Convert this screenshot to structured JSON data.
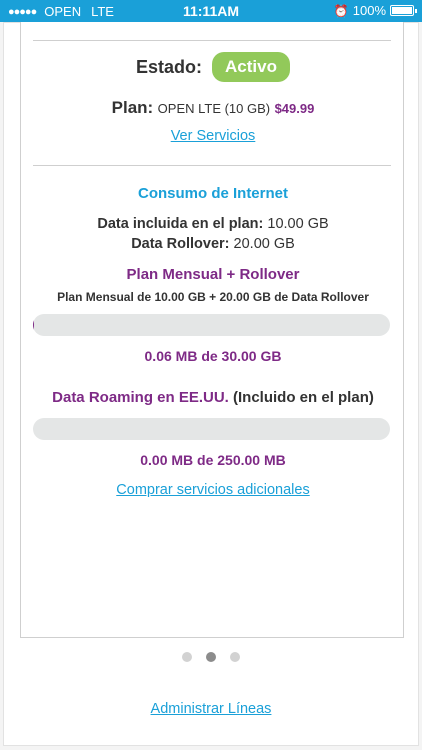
{
  "status_bar": {
    "carrier": "OPEN",
    "network": "LTE",
    "time": "11:11AM",
    "battery": "100%"
  },
  "account": {
    "estado_label": "Estado:",
    "estado_value": "Activo",
    "plan_label": "Plan:",
    "plan_name": "OPEN LTE (10 GB)",
    "plan_price": "$49.99",
    "ver_servicios": "Ver Servicios"
  },
  "internet": {
    "title": "Consumo de Internet",
    "included_label": "Data incluida en el plan:",
    "included_value": "10.00 GB",
    "rollover_label": "Data Rollover:",
    "rollover_value": "20.00 GB",
    "plan_type_title": "Plan Mensual + Rollover",
    "plan_type_desc": "Plan Mensual de 10.00 GB + 20.00 GB de Data Rollover",
    "usage_progress": 0.002,
    "usage_text": "0.06 MB de 30.00 GB",
    "roaming_title": "Data Roaming en EE.UU.",
    "roaming_note": "(Incluido en el plan)",
    "roaming_progress": 0.0,
    "roaming_usage_text": "0.00 MB de 250.00 MB",
    "comprar_link": "Comprar servicios adicionales"
  },
  "pager": {
    "count": 3,
    "active": 1
  },
  "footer": {
    "admin_link": "Administrar Líneas"
  }
}
